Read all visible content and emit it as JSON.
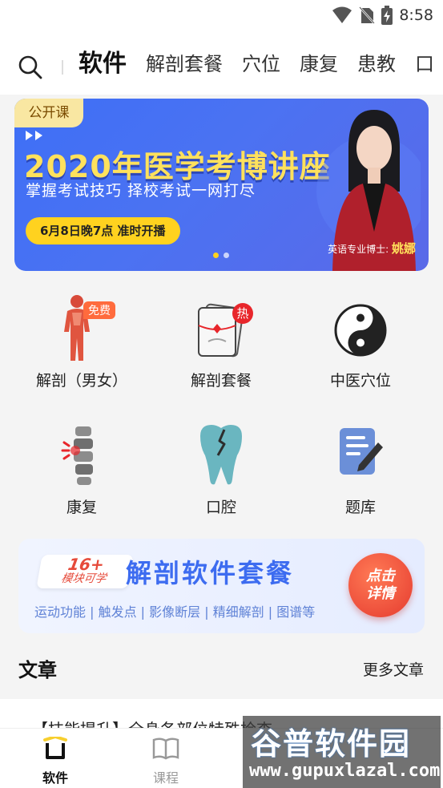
{
  "status": {
    "time": "8:58"
  },
  "topnav": {
    "tabs": [
      "软件",
      "解剖套餐",
      "穴位",
      "康复",
      "患教",
      "口"
    ]
  },
  "banner": {
    "tag": "公开课",
    "title": "2020年医学考博讲座",
    "subtitle": "掌握考试技巧  择校考试一网打尽",
    "pill": "6月8日晚7点   准时开播",
    "caption_prefix": "英语专业博士:",
    "caption_name": "姚娜"
  },
  "grid": [
    {
      "label": "解剖（男女）",
      "badge": "免费",
      "icon": "anatomy-body-icon"
    },
    {
      "label": "解剖套餐",
      "badge": "热",
      "icon": "anatomy-package-icon"
    },
    {
      "label": "中医穴位",
      "icon": "yin-yang-icon"
    },
    {
      "label": "康复",
      "icon": "spine-rehab-icon"
    },
    {
      "label": "口腔",
      "icon": "tooth-icon"
    },
    {
      "label": "题库",
      "icon": "question-bank-icon"
    }
  ],
  "promo": {
    "badge_num": "16+",
    "badge_sub": "模块可学",
    "title": "解剖软件套餐",
    "desc": "运动功能 | 触发点 | 影像断层 | 精细解剖 | 图谱等",
    "button": "点击\n详情"
  },
  "articles": {
    "title": "文章",
    "more": "更多文章",
    "snippet": "【技能提升】全身各部位特殊检查"
  },
  "bottombar": [
    {
      "label": "软件",
      "icon": "software-tab-icon",
      "active": true
    },
    {
      "label": "课程",
      "icon": "course-book-icon",
      "active": false
    }
  ],
  "watermark": {
    "main": "谷普软件园",
    "url": "www.gupuxlazal.com"
  },
  "colors": {
    "accent": "#f7cf2e",
    "banner_blue": "#3e6ff6",
    "promo_blue": "#3d6cf0",
    "badge_red": "#e8262b"
  }
}
